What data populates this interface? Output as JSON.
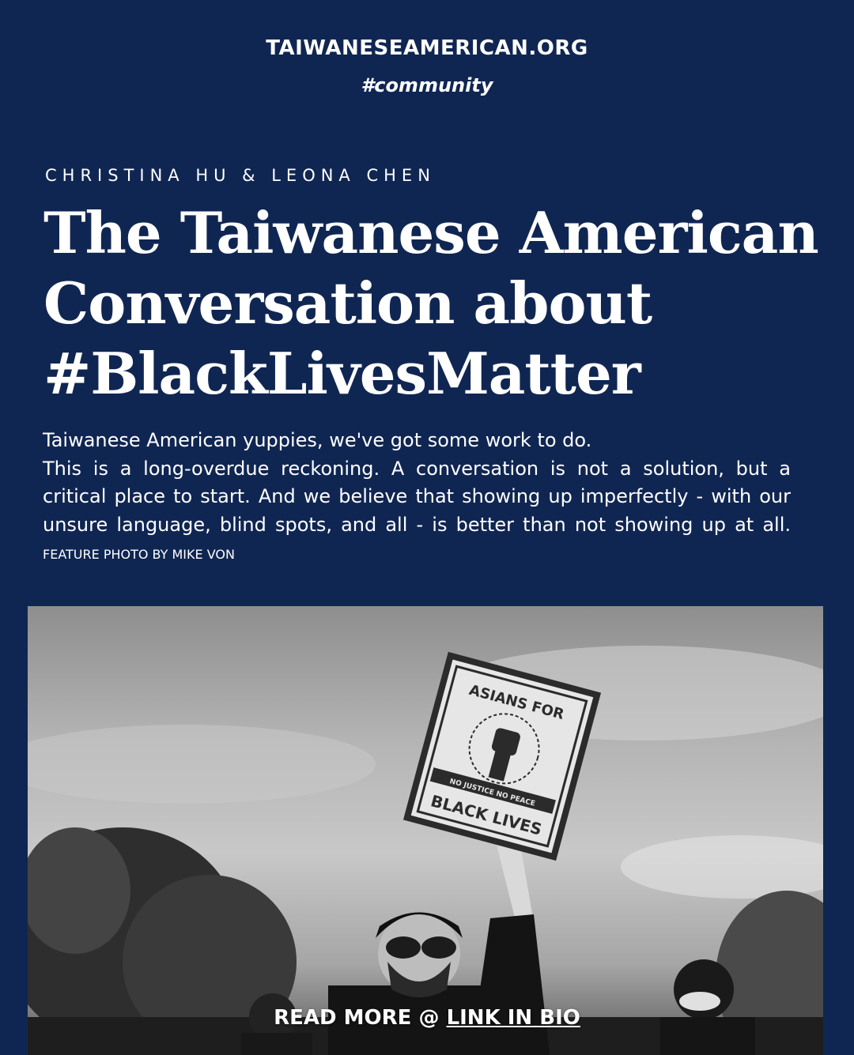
{
  "header": {
    "site": "TAIWANESEAMERICAN.ORG",
    "tag": "#community"
  },
  "article": {
    "authors": "CHRISTINA HU & LEONA CHEN",
    "title_lines": [
      "The Taiwanese American",
      "Conversation about",
      "#BlackLivesMatter"
    ],
    "intro": "Taiwanese American yuppies, we've got some work to do.",
    "body": "This is a long-overdue reckoning. A conversation is not a solution, but a critical place to start. And we believe that showing up imperfectly - with our unsure language, blind spots, and all - is better than not showing up at all.",
    "credit": "FEATURE PHOTO BY MIKE VON"
  },
  "photo": {
    "sign": {
      "top": "ASIANS FOR",
      "middle": "NO JUSTICE NO PEACE",
      "bottom": "BLACK LIVES"
    }
  },
  "footer": {
    "read_more": "READ MORE @",
    "link": "LINK IN BIO"
  },
  "colors": {
    "background": "#102652",
    "text": "#ffffff"
  }
}
